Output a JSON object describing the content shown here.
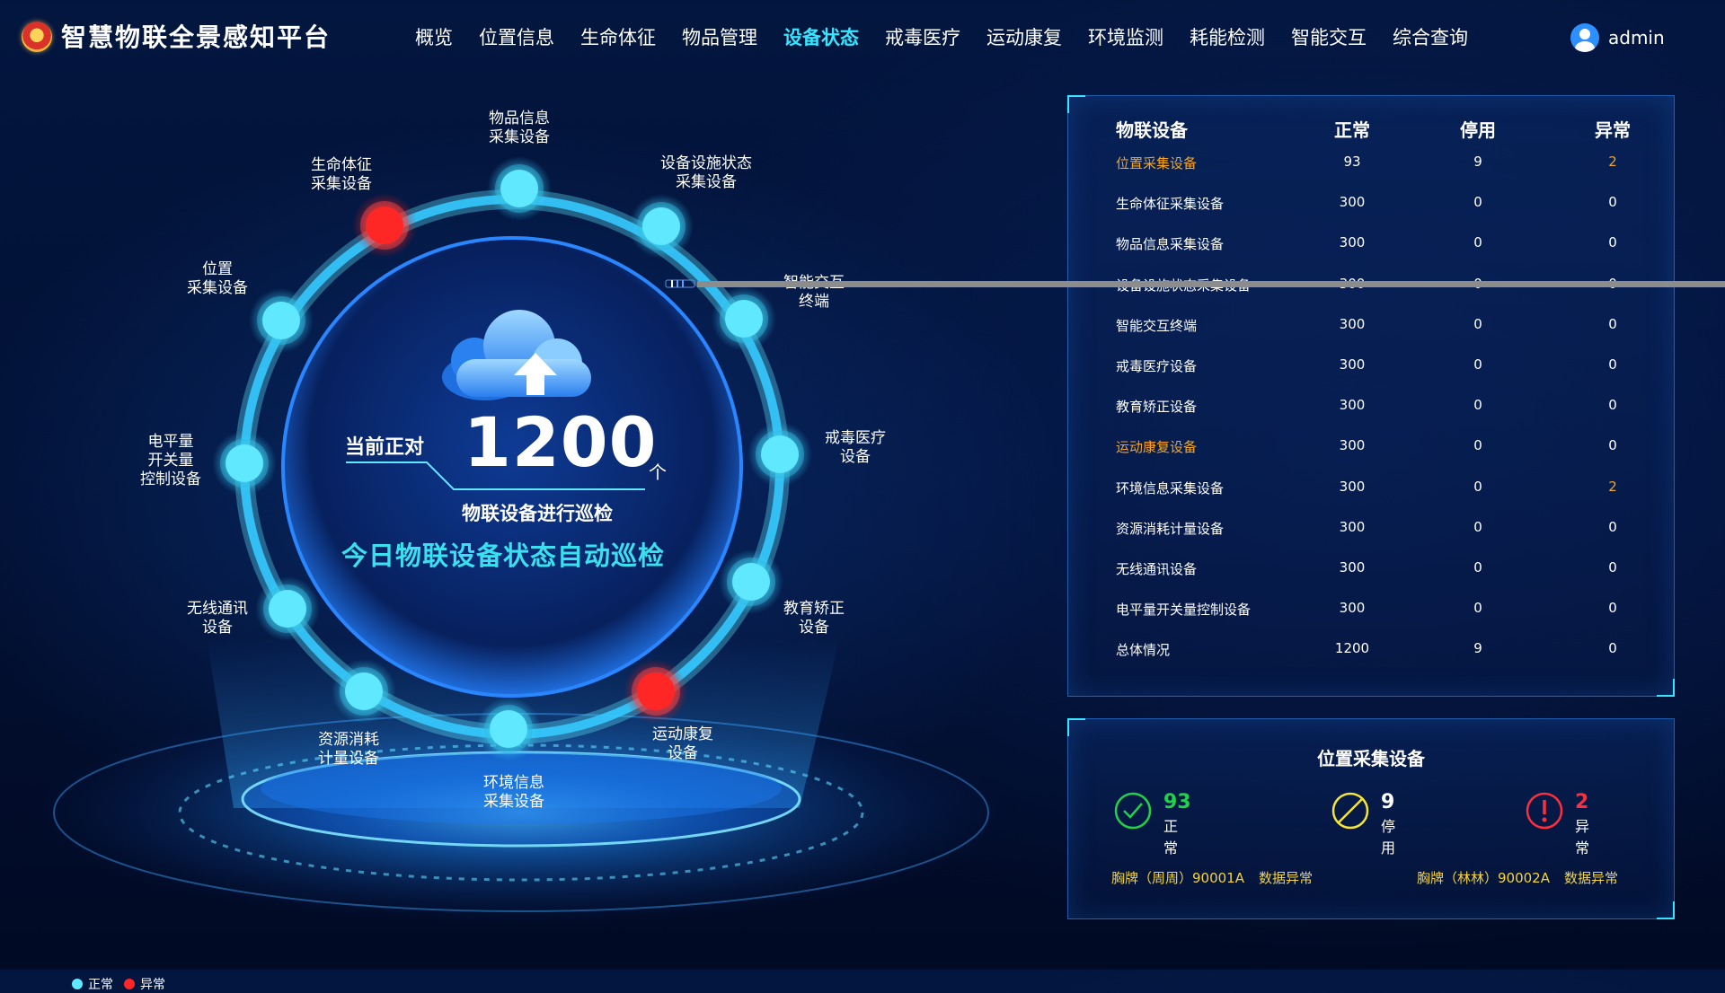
{
  "header": {
    "title": "智慧物联全景感知平台",
    "nav": [
      "概览",
      "位置信息",
      "生命体征",
      "物品管理",
      "设备状态",
      "戒毒医疗",
      "运动康复",
      "环境监测",
      "耗能检测",
      "智能交互",
      "综合查询"
    ],
    "active_nav": "设备状态",
    "user": "admin"
  },
  "visualization": {
    "center_prefix": "当前正对",
    "center_count": "1200",
    "center_unit": "个",
    "center_caption": "物联设备进行巡检",
    "center_headline": "今日物联设备状态自动巡检",
    "nodes": [
      {
        "label": "物品信息\n采集设备",
        "status": "normal"
      },
      {
        "label": "设备设施状态\n采集设备",
        "status": "normal"
      },
      {
        "label": "智能交互\n终端",
        "status": "normal"
      },
      {
        "label": "戒毒医疗\n设备",
        "status": "normal"
      },
      {
        "label": "教育矫正\n设备",
        "status": "normal"
      },
      {
        "label": "运动康复\n设备",
        "status": "abnormal"
      },
      {
        "label": "环境信息\n采集设备",
        "status": "normal"
      },
      {
        "label": "资源消耗\n计量设备",
        "status": "normal"
      },
      {
        "label": "无线通讯\n设备",
        "status": "normal"
      },
      {
        "label": "电平量\n开关量\n控制设备",
        "status": "normal"
      },
      {
        "label": "位置\n采集设备",
        "status": "normal"
      },
      {
        "label": "生命体征\n采集设备",
        "status": "abnormal"
      }
    ],
    "legend": [
      {
        "label": "正常",
        "color": "#5fe8ff"
      },
      {
        "label": "异常",
        "color": "#ff2626"
      }
    ]
  },
  "table": {
    "headers": [
      "物联设备",
      "正常",
      "停用",
      "异常"
    ],
    "rows": [
      {
        "name": "位置采集设备",
        "normal": "93",
        "disabled": "9",
        "abnormal": "2",
        "highlight_name": true,
        "highlight_abnormal": true
      },
      {
        "name": "生命体征采集设备",
        "normal": "300",
        "disabled": "0",
        "abnormal": "0",
        "highlight_name": false,
        "highlight_abnormal": false
      },
      {
        "name": "物品信息采集设备",
        "normal": "300",
        "disabled": "0",
        "abnormal": "0",
        "highlight_name": false,
        "highlight_abnormal": false
      },
      {
        "name": "设备设施状态采集设备",
        "normal": "300",
        "disabled": "0",
        "abnormal": "0",
        "highlight_name": false,
        "highlight_abnormal": false
      },
      {
        "name": "智能交互终端",
        "normal": "300",
        "disabled": "0",
        "abnormal": "0",
        "highlight_name": false,
        "highlight_abnormal": false
      },
      {
        "name": "戒毒医疗设备",
        "normal": "300",
        "disabled": "0",
        "abnormal": "0",
        "highlight_name": false,
        "highlight_abnormal": false
      },
      {
        "name": "教育矫正设备",
        "normal": "300",
        "disabled": "0",
        "abnormal": "0",
        "highlight_name": false,
        "highlight_abnormal": false
      },
      {
        "name": "运动康复设备",
        "normal": "300",
        "disabled": "0",
        "abnormal": "0",
        "highlight_name": true,
        "highlight_abnormal": false
      },
      {
        "name": "环境信息采集设备",
        "normal": "300",
        "disabled": "0",
        "abnormal": "2",
        "highlight_name": false,
        "highlight_abnormal": true
      },
      {
        "name": "资源消耗计量设备",
        "normal": "300",
        "disabled": "0",
        "abnormal": "0",
        "highlight_name": false,
        "highlight_abnormal": false
      },
      {
        "name": "无线通讯设备",
        "normal": "300",
        "disabled": "0",
        "abnormal": "0",
        "highlight_name": false,
        "highlight_abnormal": false
      },
      {
        "name": "电平量开关量控制设备",
        "normal": "300",
        "disabled": "0",
        "abnormal": "0",
        "highlight_name": false,
        "highlight_abnormal": false
      },
      {
        "name": "总体情况",
        "normal": "1200",
        "disabled": "9",
        "abnormal": "0",
        "highlight_name": false,
        "highlight_abnormal": false
      }
    ]
  },
  "detail": {
    "title": "位置采集设备",
    "normal": {
      "value": "93",
      "label": "正常",
      "color": "#22d04a"
    },
    "disabled": {
      "value": "9",
      "label": "停用",
      "color": "#f5e43a"
    },
    "abnormal": {
      "value": "2",
      "label": "异常",
      "color": "#ff2e3c"
    },
    "alerts": [
      {
        "device": "胸牌（周周）90001A",
        "status": "数据异常"
      },
      {
        "device": "胸牌（林林）90002A",
        "status": "数据异常"
      }
    ]
  },
  "colors": {
    "accent": "#36e6ff",
    "highlight": "#f5a623",
    "normal_node": "#5fe8ff",
    "abnormal_node": "#ff2626"
  }
}
